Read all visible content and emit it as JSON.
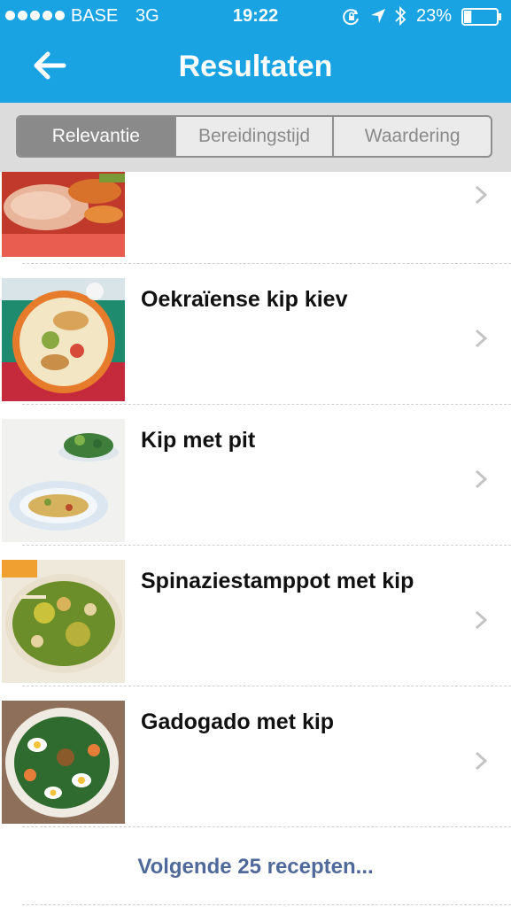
{
  "status_bar": {
    "carrier": "BASE",
    "network": "3G",
    "time": "19:22",
    "battery_percent": "23%",
    "battery_level": 0.23
  },
  "nav": {
    "title": "Resultaten",
    "back_icon": "arrow-left-icon"
  },
  "sort": {
    "options": [
      "Relevantie",
      "Bereidingstijd",
      "Waardering"
    ],
    "selected": "Relevantie"
  },
  "recipes": [
    {
      "title": "",
      "image": "chicken-roll-dish"
    },
    {
      "title": "Oekraïense kip kiev",
      "image": "chicken-kiev-rice-bowl"
    },
    {
      "title": "Kip met pit",
      "image": "noodle-plate-with-salad"
    },
    {
      "title": "Spinaziestamppot met kip",
      "image": "spinach-stew-plate"
    },
    {
      "title": "Gadogado met kip",
      "image": "egg-salad-plate"
    }
  ],
  "more_link": "Volgende 25 recepten...",
  "colors": {
    "header": "#1aa3e2",
    "segment_active": "#8a8a8a",
    "link": "#4f6a9a"
  }
}
